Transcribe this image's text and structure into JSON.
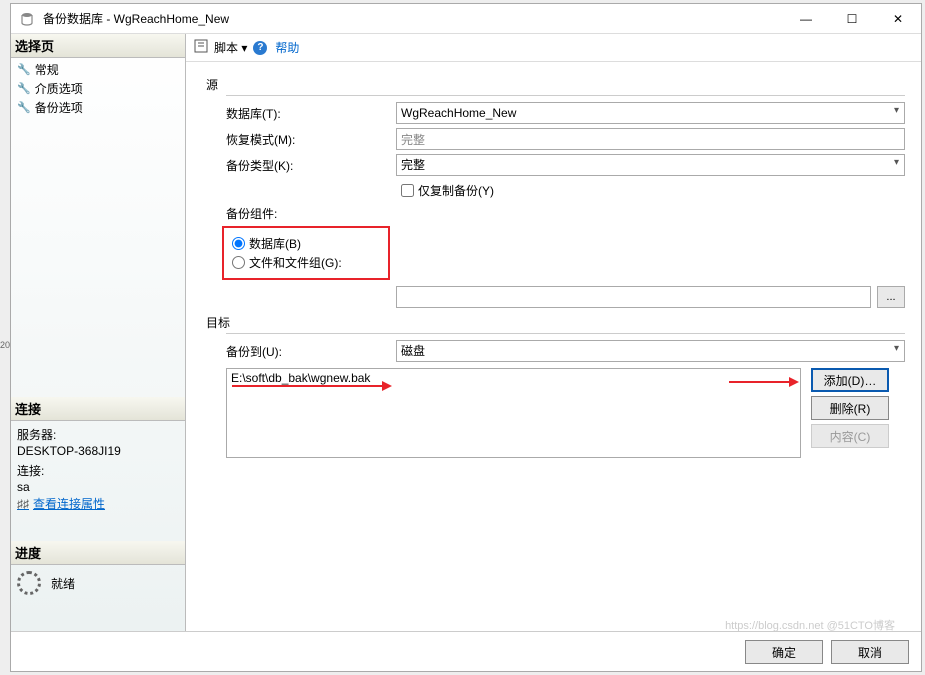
{
  "window": {
    "title": "备份数据库 - WgReachHome_New"
  },
  "winbtns": {
    "min": "—",
    "max": "☐",
    "close": "✕"
  },
  "sidebar": {
    "select_pages": "选择页",
    "items": [
      "常规",
      "介质选项",
      "备份选项"
    ],
    "connection_hdr": "连接",
    "server_label": "服务器:",
    "server_value": "DESKTOP-368JI19",
    "conn_label": "连接:",
    "conn_value": "sa",
    "view_props": "查看连接属性",
    "progress_hdr": "进度",
    "ready": "就绪"
  },
  "toolbar": {
    "script_label": "脚本",
    "help_label": "帮助"
  },
  "form": {
    "source_group": "源",
    "db_label": "数据库(T):",
    "db_value": "WgReachHome_New",
    "recovery_label": "恢复模式(M):",
    "recovery_value": "完整",
    "backup_type_label": "备份类型(K):",
    "backup_type_value": "完整",
    "copy_only": "仅复制备份(Y)",
    "component_label": "备份组件:",
    "radio_db": "数据库(B)",
    "radio_fg": "文件和文件组(G):",
    "dest_group": "目标",
    "backup_to_label": "备份到(U):",
    "backup_to_value": "磁盘",
    "dest_path": "E:\\soft\\db_bak\\wgnew.bak",
    "btn_add": "添加(D)…",
    "btn_remove": "删除(R)",
    "btn_content": "内容(C)",
    "ellipsis": "..."
  },
  "footer": {
    "ok": "确定",
    "cancel": "取消"
  },
  "watermark": "https://blog.csdn.net @51CTO博客",
  "left_marker": "20"
}
